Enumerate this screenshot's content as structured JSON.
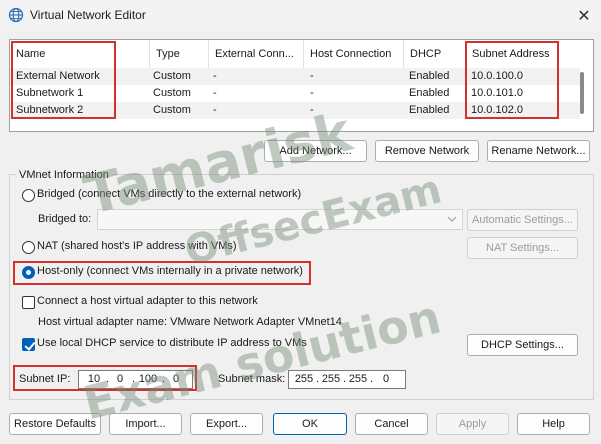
{
  "window": {
    "title": "Virtual Network Editor",
    "close_glyph": "✕",
    "icon": "globe-icon"
  },
  "table": {
    "columns": [
      "Name",
      "Type",
      "External Conn...",
      "Host Connection",
      "DHCP",
      "Subnet Address"
    ],
    "rows": [
      {
        "name": "External Network",
        "type": "Custom",
        "external": "-",
        "host": "-",
        "dhcp": "Enabled",
        "subnet": "10.0.100.0"
      },
      {
        "name": "Subnetwork 1",
        "type": "Custom",
        "external": "-",
        "host": "-",
        "dhcp": "Enabled",
        "subnet": "10.0.101.0"
      },
      {
        "name": "Subnetwork 2",
        "type": "Custom",
        "external": "-",
        "host": "-",
        "dhcp": "Enabled",
        "subnet": "10.0.102.0"
      }
    ]
  },
  "table_buttons": {
    "add": "Add Network...",
    "remove": "Remove Network",
    "rename": "Rename Network..."
  },
  "vmnet": {
    "group_title": "VMnet Information",
    "bridged_label": "Bridged (connect VMs directly to the external network)",
    "bridged_to_label": "Bridged to:",
    "auto_settings": "Automatic Settings...",
    "nat_label": "NAT (shared host's IP address with VMs)",
    "nat_settings": "NAT Settings...",
    "hostonly_label": "Host-only (connect VMs internally in a private network)",
    "selected_mode": "host-only",
    "connect_adapter_label": "Connect a host virtual adapter to this network",
    "connect_adapter_checked": false,
    "adapter_name_label": "Host virtual adapter name: VMware Network Adapter VMnet14",
    "dhcp_label": "Use local DHCP service to distribute IP address to VMs",
    "dhcp_checked": true,
    "dhcp_settings": "DHCP Settings..."
  },
  "subnet": {
    "ip_label": "Subnet IP:",
    "ip": [
      "10",
      "0",
      "100",
      "0"
    ],
    "mask_label": "Subnet mask:",
    "mask": [
      "255",
      "255",
      "255",
      "0"
    ],
    "dot": "."
  },
  "footer": {
    "restore": "Restore Defaults",
    "import": "Import...",
    "export": "Export...",
    "ok": "OK",
    "cancel": "Cancel",
    "apply": "Apply",
    "help": "Help"
  },
  "watermark": {
    "line1": "Tamarisk",
    "line2": "OffsecExam",
    "line3": "Exam solution"
  },
  "colors": {
    "highlight": "#d43030",
    "accent": "#005fb8"
  }
}
